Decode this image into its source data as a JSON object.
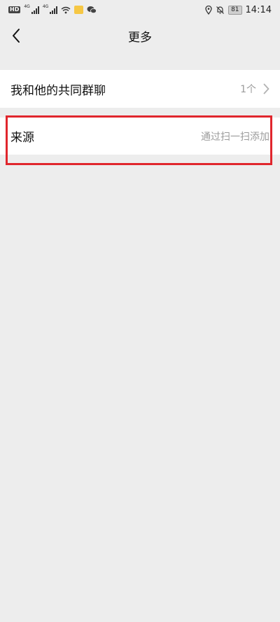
{
  "status_bar": {
    "hd_badge": "HD",
    "sim1_label": "4G",
    "sim2_label": "4G",
    "battery": "81",
    "time": "14:14",
    "icons": [
      "hd-icon",
      "signal-icon",
      "signal-icon",
      "wifi-icon",
      "app-icon",
      "wechat-icon",
      "location-icon",
      "mute-bell-icon",
      "battery-icon"
    ]
  },
  "nav": {
    "title": "更多",
    "back_icon": "chevron-left-icon"
  },
  "list": {
    "common_groups": {
      "label": "我和他的共同群聊",
      "value": "1个"
    },
    "source": {
      "label": "来源",
      "value": "通过扫一扫添加"
    }
  },
  "colors": {
    "background": "#ededed",
    "cell": "#ffffff",
    "secondary_text": "#9b9b9b",
    "highlight": "#e0262d"
  }
}
